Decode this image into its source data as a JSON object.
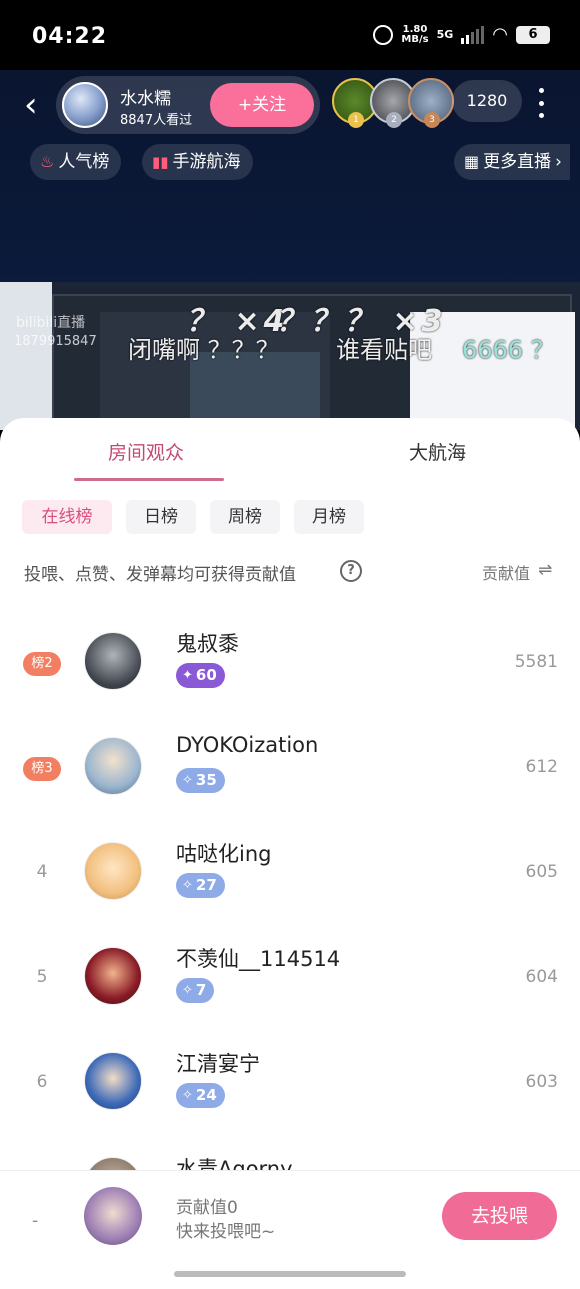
{
  "status_bar": {
    "time": "04:22",
    "net_speed_value": "1.80",
    "net_speed_unit": "MB/s",
    "network": "5G",
    "battery": "6"
  },
  "header": {
    "anchor_name": "水水糯",
    "anchor_views": "8847人看过",
    "follow_label": "+关注",
    "viewer_count": "1280",
    "top3_medals": [
      "1",
      "2",
      "3"
    ]
  },
  "chips": {
    "popular": "人气榜",
    "fleet": "手游航海",
    "more_live": "更多直播"
  },
  "stream": {
    "watermark": "bilibili直播",
    "uid": "1879915847",
    "danmu": [
      {
        "text": "？ ×4"
      },
      {
        "text": "？？？ ×3"
      },
      {
        "text": "闭嘴啊 ？？？"
      },
      {
        "text": "谁看贴吧"
      },
      {
        "text": "6666 ？"
      }
    ]
  },
  "sheet": {
    "tabs": [
      "房间观众",
      "大航海"
    ],
    "rank_tabs": [
      "在线榜",
      "日榜",
      "周榜",
      "月榜"
    ],
    "hint": "投喂、点赞、发弹幕均可获得贡献值",
    "contrib_header": "贡献值",
    "rows": [
      {
        "rank": "榜2",
        "name": "鬼叔黍",
        "level": "60",
        "score": "5581"
      },
      {
        "rank": "榜3",
        "name": "DYOKOization",
        "level": "35",
        "score": "612"
      },
      {
        "rank": "4",
        "name": "咕哒化ing",
        "level": "27",
        "score": "605"
      },
      {
        "rank": "5",
        "name": "不羡仙__114514",
        "level": "7",
        "score": "604"
      },
      {
        "rank": "6",
        "name": "江清宴宁",
        "level": "24",
        "score": "603"
      },
      {
        "rank": "",
        "name": "水青Agorny",
        "level": "",
        "score": ""
      }
    ]
  },
  "bottom_bar": {
    "my_rank": "-",
    "my_contrib": "贡献值0",
    "prompt": "快来投喂吧~",
    "feed_button": "去投喂"
  },
  "colors": {
    "accent_pink": "#f06b96",
    "rank_badge": "#f37f62",
    "level_purple": "#8a5ad6",
    "level_blue": "#8eabe8"
  }
}
